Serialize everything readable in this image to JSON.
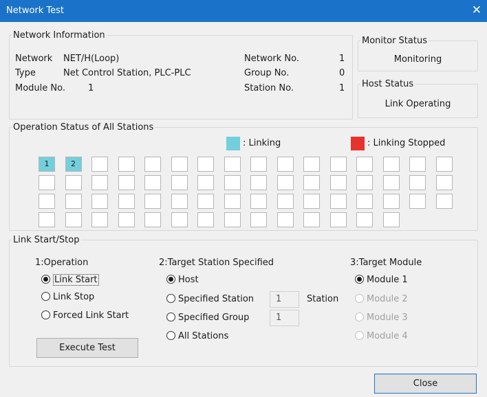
{
  "window": {
    "title": "Network Test",
    "close_glyph": "✕"
  },
  "network_info": {
    "legend": "Network Information",
    "network_label": "Network",
    "network_value": "NET/H(Loop)",
    "type_label": "Type",
    "type_value": "Net Control Station, PLC-PLC",
    "module_label": "Module No.",
    "module_value": "1",
    "network_no_label": "Network No.",
    "network_no_value": "1",
    "group_no_label": "Group No.",
    "group_no_value": "0",
    "station_no_label": "Station No.",
    "station_no_value": "1"
  },
  "monitor_status": {
    "legend": "Monitor Status",
    "value": "Monitoring"
  },
  "host_status": {
    "legend": "Host Status",
    "value": "Link Operating"
  },
  "operation_status": {
    "legend": "Operation Status of All Stations",
    "linking_label": ": Linking",
    "stopped_label": ": Linking Stopped",
    "colors": {
      "linking": "#74cfdc",
      "stopped": "#e8322e",
      "idle": "#ffffff"
    },
    "stations": [
      "1",
      "2",
      "",
      "",
      "",
      "",
      "",
      "",
      "",
      "",
      "",
      "",
      "",
      "",
      "",
      "",
      "",
      "",
      "",
      "",
      "",
      "",
      "",
      "",
      "",
      "",
      "",
      "",
      "",
      "",
      "",
      "",
      "",
      "",
      "",
      "",
      "",
      "",
      "",
      "",
      "",
      "",
      "",
      "",
      "",
      "",
      "",
      "",
      "",
      "",
      "",
      "",
      "",
      "",
      "",
      "",
      "",
      "",
      "",
      "",
      "",
      ""
    ]
  },
  "link": {
    "legend": "Link Start/Stop",
    "operation_title": "1:Operation",
    "operation_options": [
      "Link Start",
      "Link Stop",
      "Forced Link Start"
    ],
    "target_title": "2:Target Station Specified",
    "target_options": [
      "Host",
      "Specified Station",
      "Specified Group",
      "All Stations"
    ],
    "station_value": "1",
    "group_value": "1",
    "station_suffix": "Station",
    "module_title": "3:Target Module",
    "module_options": [
      "Module 1",
      "Module 2",
      "Module 3",
      "Module 4"
    ],
    "execute_label": "Execute Test"
  },
  "footer": {
    "close_label": "Close"
  }
}
